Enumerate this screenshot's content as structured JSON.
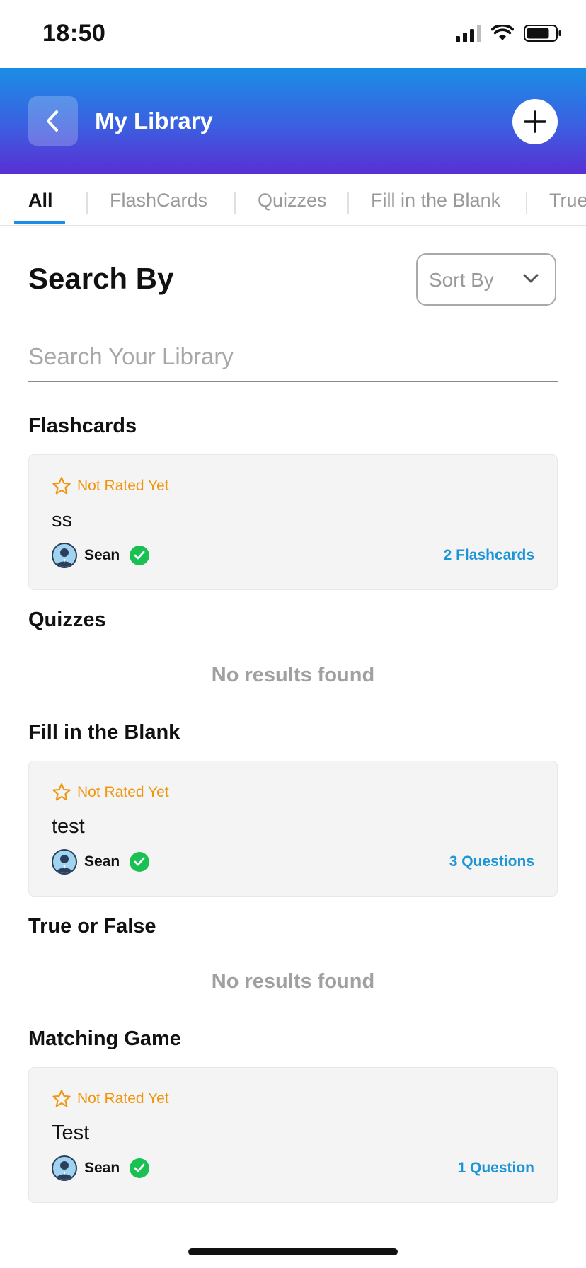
{
  "status_bar": {
    "time": "18:50"
  },
  "header": {
    "title": "My Library"
  },
  "tabs": [
    {
      "label": "All",
      "active": true
    },
    {
      "label": "FlashCards",
      "active": false
    },
    {
      "label": "Quizzes",
      "active": false
    },
    {
      "label": "Fill in the Blank",
      "active": false
    },
    {
      "label": "True",
      "active": false
    }
  ],
  "search": {
    "heading": "Search By",
    "sort_label": "Sort By",
    "placeholder": "Search Your Library",
    "value": ""
  },
  "sections": [
    {
      "title": "Flashcards",
      "items": [
        {
          "rating": "Not Rated Yet",
          "title": "ss",
          "author": "Sean",
          "count": "2 Flashcards"
        }
      ]
    },
    {
      "title": "Quizzes",
      "empty_text": "No results found"
    },
    {
      "title": "Fill in the Blank",
      "items": [
        {
          "rating": "Not Rated Yet",
          "title": "test",
          "author": "Sean",
          "count": "3 Questions"
        }
      ]
    },
    {
      "title": "True or False",
      "empty_text": "No results found"
    },
    {
      "title": "Matching Game",
      "items": [
        {
          "rating": "Not Rated Yet",
          "title": "Test",
          "author": "Sean",
          "count": "1 Question"
        }
      ]
    }
  ],
  "colors": {
    "header_gradient": [
      "#1a8ee6",
      "#5a2fd4"
    ],
    "accent": "#1b95d6",
    "rating": "#f0960e",
    "verified": "#19c152"
  }
}
